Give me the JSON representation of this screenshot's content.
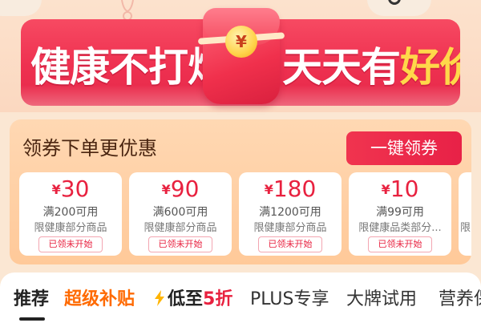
{
  "banner": {
    "slogan_left": "健康不打烊",
    "slogan_right_main": "天天有",
    "slogan_right_accent": "好价",
    "envelope_icon": "red-envelope-icon",
    "coin_symbol": "¥"
  },
  "coupons": {
    "title": "领券下单更优惠",
    "claim_all_label": "一键领券",
    "currency": "¥",
    "items": [
      {
        "amount": "30",
        "condition": "满200可用",
        "scope": "限健康部分商品",
        "status": "已领未开始"
      },
      {
        "amount": "90",
        "condition": "满600可用",
        "scope": "限健康部分商品",
        "status": "已领未开始"
      },
      {
        "amount": "180",
        "condition": "满1200可用",
        "scope": "限健康部分商品",
        "status": "已领未开始"
      },
      {
        "amount": "10",
        "condition": "满99可用",
        "scope": "限健康品类部分...",
        "status": "已领未开始"
      },
      {
        "scope": "限"
      }
    ]
  },
  "tabs": {
    "items": [
      {
        "label": "推荐"
      },
      {
        "label": "超级补贴"
      },
      {
        "label_main": "低至",
        "label_accent": "5折"
      },
      {
        "label": "PLUS专享"
      },
      {
        "label": "大牌试用"
      },
      {
        "label": "营养保健"
      }
    ]
  },
  "colors": {
    "accent_red": "#e8213f",
    "super_orange": "#ff6a00",
    "price_yellow": "#ffd84a",
    "panel_peach": "#ffd8b3"
  }
}
